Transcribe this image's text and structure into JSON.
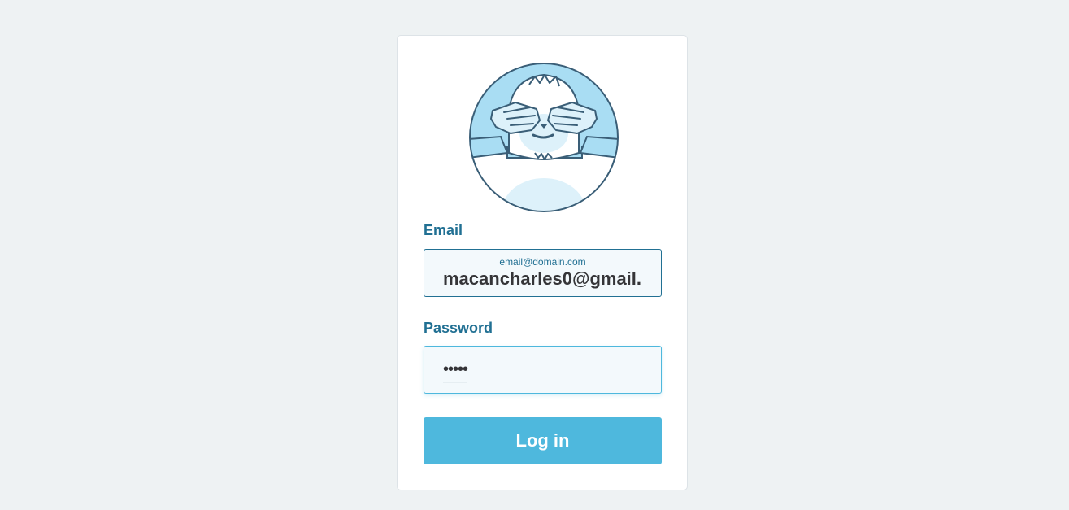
{
  "form": {
    "email_label": "Email",
    "email_helper": "email@domain.com",
    "email_value": "macancharles0@gmail.",
    "password_label": "Password",
    "password_value": "•••••",
    "login_button": "Log in"
  },
  "mascot": {
    "icon": "yeti-covering-eyes-icon"
  },
  "colors": {
    "background": "#eef2f3",
    "accent": "#4eb8dd",
    "label": "#217093",
    "field_bg": "#f3f9fc"
  }
}
